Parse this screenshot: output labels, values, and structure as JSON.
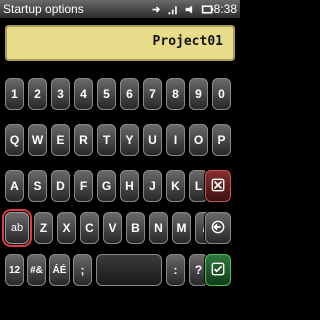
{
  "statusbar": {
    "title": "Startup options",
    "time": "8:38"
  },
  "editor": {
    "value": "Project01"
  },
  "keyboard": {
    "row1": [
      "1",
      "2",
      "3",
      "4",
      "5",
      "6",
      "7",
      "8",
      "9",
      "0"
    ],
    "row2": [
      "Q",
      "W",
      "E",
      "R",
      "T",
      "Y",
      "U",
      "I",
      "O",
      "P"
    ],
    "row3": [
      "A",
      "S",
      "D",
      "F",
      "G",
      "H",
      "J",
      "K",
      "L"
    ],
    "row4": [
      "ab",
      "Z",
      "X",
      "C",
      "V",
      "B",
      "N",
      "M",
      "/"
    ],
    "row5": [
      "12",
      "#&",
      "ÁÉ",
      ";",
      ":",
      "?"
    ]
  },
  "icons": {
    "delete": "close-icon",
    "enter": "left-arrow-icon",
    "ok": "check-icon"
  }
}
